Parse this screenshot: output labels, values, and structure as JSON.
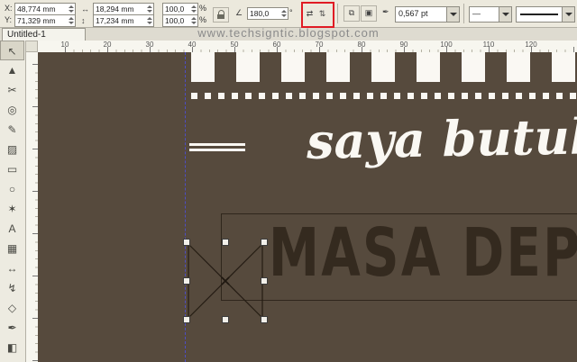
{
  "property_bar": {
    "x_label": "X:",
    "y_label": "Y:",
    "x_value": "48,774 mm",
    "y_value": "71,329 mm",
    "width_value": "18,294 mm",
    "height_value": "17,234 mm",
    "scale_h_value": "100,0",
    "scale_v_value": "100,0",
    "percent_label": "%",
    "angle_value": "180,0",
    "degree_label": "°",
    "outline_width_value": "0,567 pt",
    "line_style_value": "—",
    "highlight_color": "#e01b24",
    "icons": {
      "width": "↔",
      "height": "↕",
      "angle": "∠",
      "mirror_h": "⇄",
      "mirror_v": "⇅",
      "convert": "⧉",
      "wrap": "▣",
      "pen": "✒"
    }
  },
  "tab_bar": {
    "document_tab": "Untitled-1",
    "watermark": "www.techsigntic.blogspot.com"
  },
  "rulers": {
    "horizontal_numbers": [
      "10",
      "20",
      "30",
      "40",
      "50",
      "60",
      "70",
      "80",
      "90",
      "100",
      "110",
      "120"
    ]
  },
  "toolbox": {
    "tools": [
      {
        "name": "pick-tool",
        "glyph": "↖"
      },
      {
        "name": "shape-tool",
        "glyph": "▲"
      },
      {
        "name": "crop-tool",
        "glyph": "✂"
      },
      {
        "name": "zoom-tool",
        "glyph": "◎"
      },
      {
        "name": "freehand-tool",
        "glyph": "✎"
      },
      {
        "name": "smart-fill-tool",
        "glyph": "▨"
      },
      {
        "name": "rectangle-tool",
        "glyph": "▭"
      },
      {
        "name": "ellipse-tool",
        "glyph": "○"
      },
      {
        "name": "polygon-tool",
        "glyph": "✶"
      },
      {
        "name": "text-tool",
        "glyph": "A"
      },
      {
        "name": "table-tool",
        "glyph": "▦"
      },
      {
        "name": "dimension-tool",
        "glyph": "↔"
      },
      {
        "name": "connector-tool",
        "glyph": "↯"
      },
      {
        "name": "blend-tool",
        "glyph": "◇"
      },
      {
        "name": "outline-pen-tool",
        "glyph": "✒"
      },
      {
        "name": "fill-tool",
        "glyph": "◧"
      }
    ]
  },
  "canvas": {
    "background_color": "#564a3d",
    "script_text": "saya butuh",
    "headline_text": "MASA DEPA",
    "headline_color": "#342a1f"
  }
}
